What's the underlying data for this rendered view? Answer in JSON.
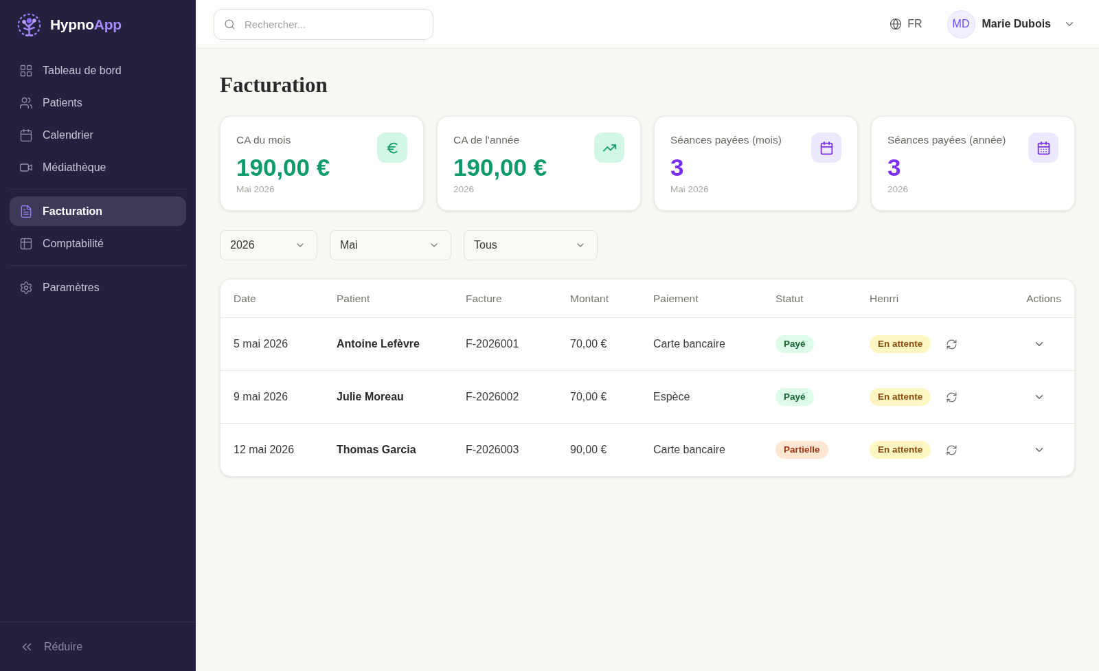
{
  "sidebar": {
    "brand": {
      "name": "Hypno",
      "accent": "App"
    },
    "groups": [
      {
        "items": [
          {
            "label": "Tableau de bord",
            "selected": false
          },
          {
            "label": "Patients",
            "selected": false
          },
          {
            "label": "Calendrier",
            "selected": false
          },
          {
            "label": "Médiathèque",
            "selected": false
          }
        ]
      },
      {
        "items": [
          {
            "label": "Facturation",
            "selected": true
          },
          {
            "label": "Comptabilité",
            "selected": false
          }
        ]
      },
      {
        "items": [
          {
            "label": "Paramètres",
            "selected": false
          }
        ]
      }
    ],
    "collapse_label": "Réduire"
  },
  "header": {
    "search": {
      "placeholder": "Rechercher..."
    },
    "language": "FR",
    "user": {
      "initials": "MD",
      "name": "Marie Dubois"
    }
  },
  "page_title": "Facturation",
  "stats": [
    {
      "label": "CA du mois",
      "value": "190,00 €",
      "caption": "Mai 2026",
      "kind": "amount"
    },
    {
      "label": "CA de l'année",
      "value": "190,00 €",
      "caption": "2026",
      "kind": "amount"
    },
    {
      "label": "Séances payées (mois)",
      "value": "3",
      "caption": "Mai 2026",
      "kind": "count"
    },
    {
      "label": "Séances payées (année)",
      "value": "3",
      "caption": "2026",
      "kind": "count"
    }
  ],
  "filters": [
    {
      "value": "2026"
    },
    {
      "value": "Mai"
    },
    {
      "value": "Tous"
    }
  ],
  "table": {
    "columns": [
      "Date",
      "Patient",
      "Facture",
      "Montant",
      "Paiement",
      "Statut",
      "Henrri",
      "Actions"
    ],
    "rows": [
      {
        "date": "5 mai 2026",
        "patient": "Antoine Lefèvre",
        "invoice": "F-2026001",
        "amount": "70,00 €",
        "payment": "Carte bancaire",
        "status": {
          "label": "Payé",
          "kind": "paid"
        },
        "henrri": {
          "label": "En attente",
          "kind": "pending"
        }
      },
      {
        "date": "9 mai 2026",
        "patient": "Julie Moreau",
        "invoice": "F-2026002",
        "amount": "70,00 €",
        "payment": "Espèce",
        "status": {
          "label": "Payé",
          "kind": "paid"
        },
        "henrri": {
          "label": "En attente",
          "kind": "pending"
        }
      },
      {
        "date": "12 mai 2026",
        "patient": "Thomas Garcia",
        "invoice": "F-2026003",
        "amount": "90,00 €",
        "payment": "Carte bancaire",
        "status": {
          "label": "Partielle",
          "kind": "partial"
        },
        "henrri": {
          "label": "En attente",
          "kind": "pending"
        }
      }
    ]
  }
}
